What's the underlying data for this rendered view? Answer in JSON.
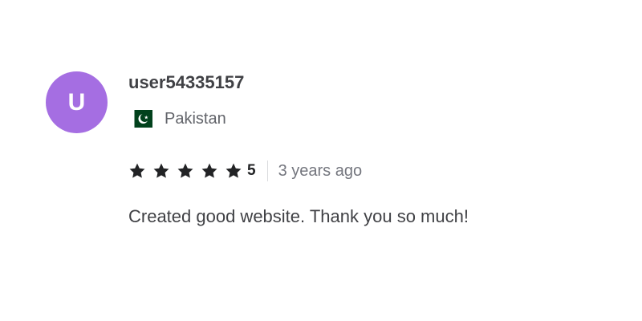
{
  "review": {
    "avatar_letter": "U",
    "avatar_color": "#a56ee2",
    "username": "user54335157",
    "country": {
      "name": "Pakistan",
      "flag_icon": "pakistan-flag-icon"
    },
    "rating": {
      "stars": 5,
      "value": "5",
      "star_icon": "star-icon",
      "star_color": "#222325"
    },
    "time_ago": "3 years ago",
    "comment": "Created good website. Thank you so much!"
  }
}
